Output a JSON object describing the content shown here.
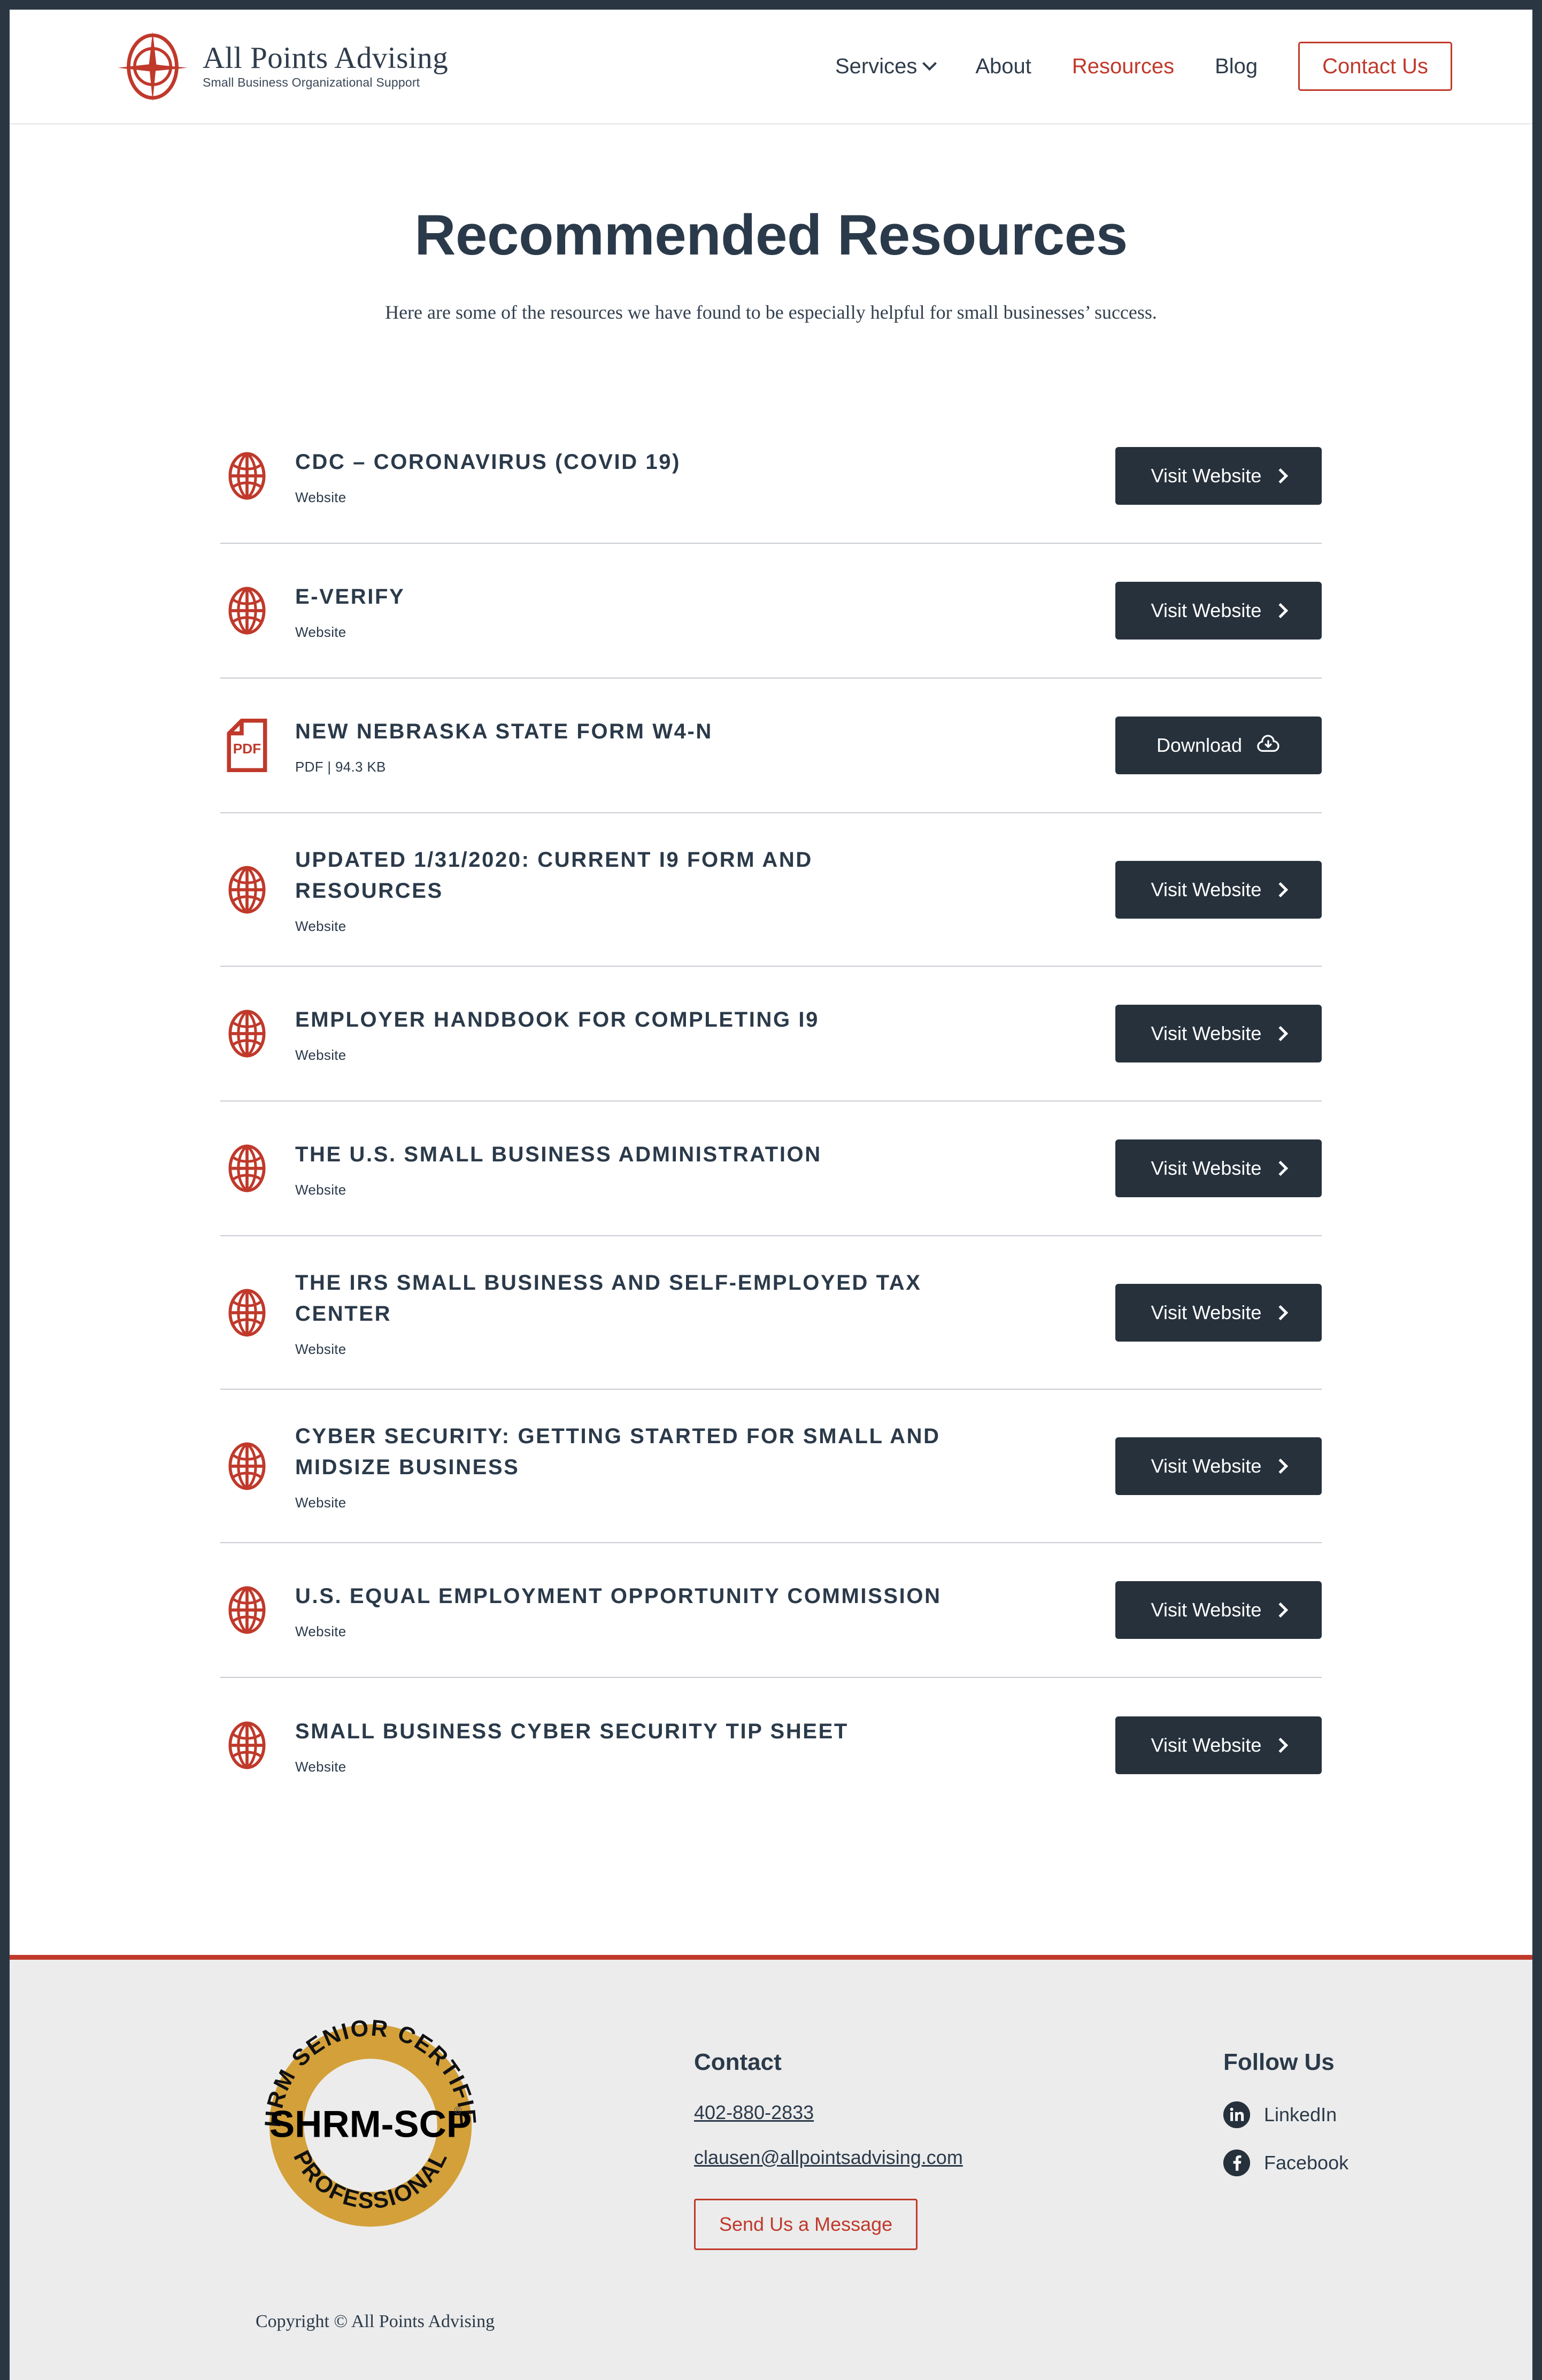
{
  "brand": {
    "name": "All Points Advising",
    "tagline": "Small Business Organizational Support",
    "logo_icon": "compass-rose-icon",
    "accent_color": "#c0392b",
    "dark_color": "#2b3a4a"
  },
  "nav": {
    "items": [
      {
        "label": "Services",
        "active": false,
        "has_dropdown": true
      },
      {
        "label": "About",
        "active": false,
        "has_dropdown": false
      },
      {
        "label": "Resources",
        "active": true,
        "has_dropdown": false
      },
      {
        "label": "Blog",
        "active": false,
        "has_dropdown": false
      }
    ],
    "cta_label": "Contact Us"
  },
  "main": {
    "title": "Recommended Resources",
    "subtitle": "Here are some of the resources we have found to be especially helpful for small businesses’ success."
  },
  "resources": [
    {
      "title": "CDC – Coronavirus (COVID 19)",
      "meta": "Website",
      "icon": "globe-icon",
      "action_label": "Visit Website",
      "action_icon": "chevron-right-icon"
    },
    {
      "title": "E-Verify",
      "meta": "Website",
      "icon": "globe-icon",
      "action_label": "Visit Website",
      "action_icon": "chevron-right-icon"
    },
    {
      "title": "New Nebraska State Form W4-N",
      "meta": "PDF | 94.3 KB",
      "icon": "pdf-file-icon",
      "action_label": "Download",
      "action_icon": "cloud-download-icon"
    },
    {
      "title": "Updated 1/31/2020: Current I9 Form and Resources",
      "meta": "Website",
      "icon": "globe-icon",
      "action_label": "Visit Website",
      "action_icon": "chevron-right-icon"
    },
    {
      "title": "Employer Handbook for Completing I9",
      "meta": "Website",
      "icon": "globe-icon",
      "action_label": "Visit Website",
      "action_icon": "chevron-right-icon"
    },
    {
      "title": "The U.S. Small Business Administration",
      "meta": "Website",
      "icon": "globe-icon",
      "action_label": "Visit Website",
      "action_icon": "chevron-right-icon"
    },
    {
      "title": "The IRS Small Business and Self-Employed Tax Center",
      "meta": "Website",
      "icon": "globe-icon",
      "action_label": "Visit Website",
      "action_icon": "chevron-right-icon"
    },
    {
      "title": "Cyber Security: Getting Started for Small and Midsize Business",
      "meta": "Website",
      "icon": "globe-icon",
      "action_label": "Visit Website",
      "action_icon": "chevron-right-icon"
    },
    {
      "title": "U.S. Equal Employment Opportunity Commission",
      "meta": "Website",
      "icon": "globe-icon",
      "action_label": "Visit Website",
      "action_icon": "chevron-right-icon"
    },
    {
      "title": "Small Business Cyber Security Tip Sheet",
      "meta": "Website",
      "icon": "globe-icon",
      "action_label": "Visit Website",
      "action_icon": "chevron-right-icon"
    }
  ],
  "footer": {
    "badge": {
      "top_text": "SHRM SENIOR CERTIFIED",
      "bottom_text": "PROFESSIONAL",
      "center_text": "SHRM-SCP",
      "registered_mark": "®",
      "color": "#d4a03a"
    },
    "contact": {
      "heading": "Contact",
      "phone": "402-880-2833",
      "email": "clausen@allpointsadvising.com",
      "button_label": "Send Us a Message"
    },
    "social": {
      "heading": "Follow Us",
      "items": [
        {
          "label": "LinkedIn",
          "icon": "linkedin-icon"
        },
        {
          "label": "Facebook",
          "icon": "facebook-icon"
        }
      ]
    },
    "copyright": "Copyright © All Points Advising"
  }
}
